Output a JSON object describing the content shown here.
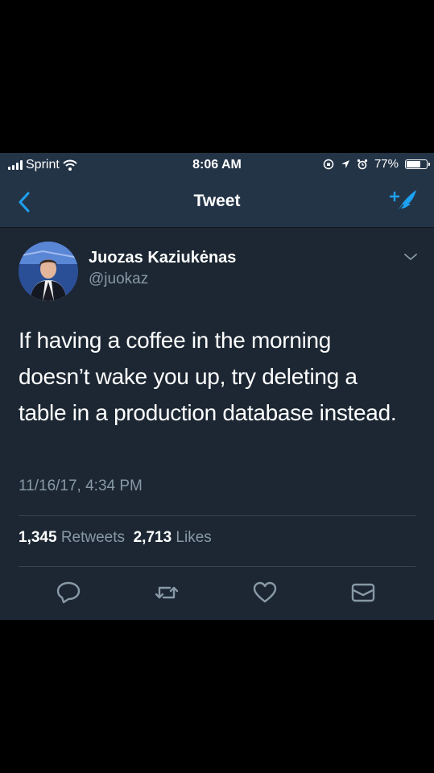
{
  "status_bar": {
    "carrier": "Sprint",
    "time": "8:06 AM",
    "battery_percent": "77%",
    "battery_level": 0.77
  },
  "nav": {
    "title": "Tweet",
    "back_icon": "chevron-left-icon",
    "compose_icon": "compose-tweet-icon"
  },
  "tweet": {
    "author_name": "Juozas Kaziukėnas",
    "author_handle": "@juokaz",
    "text": "If having a coffee in the morning doesn’t wake you up, try deleting a table in a production database instead.",
    "timestamp": "11/16/17, 4:34 PM",
    "retweets_count": "1,345",
    "retweets_label": "Retweets",
    "likes_count": "2,713",
    "likes_label": "Likes"
  },
  "actions": [
    "reply-icon",
    "retweet-icon",
    "like-icon",
    "message-icon"
  ],
  "colors": {
    "background": "#1c2733",
    "bar": "#243447",
    "accent": "#1da1f2",
    "secondary_text": "#8899a6"
  }
}
